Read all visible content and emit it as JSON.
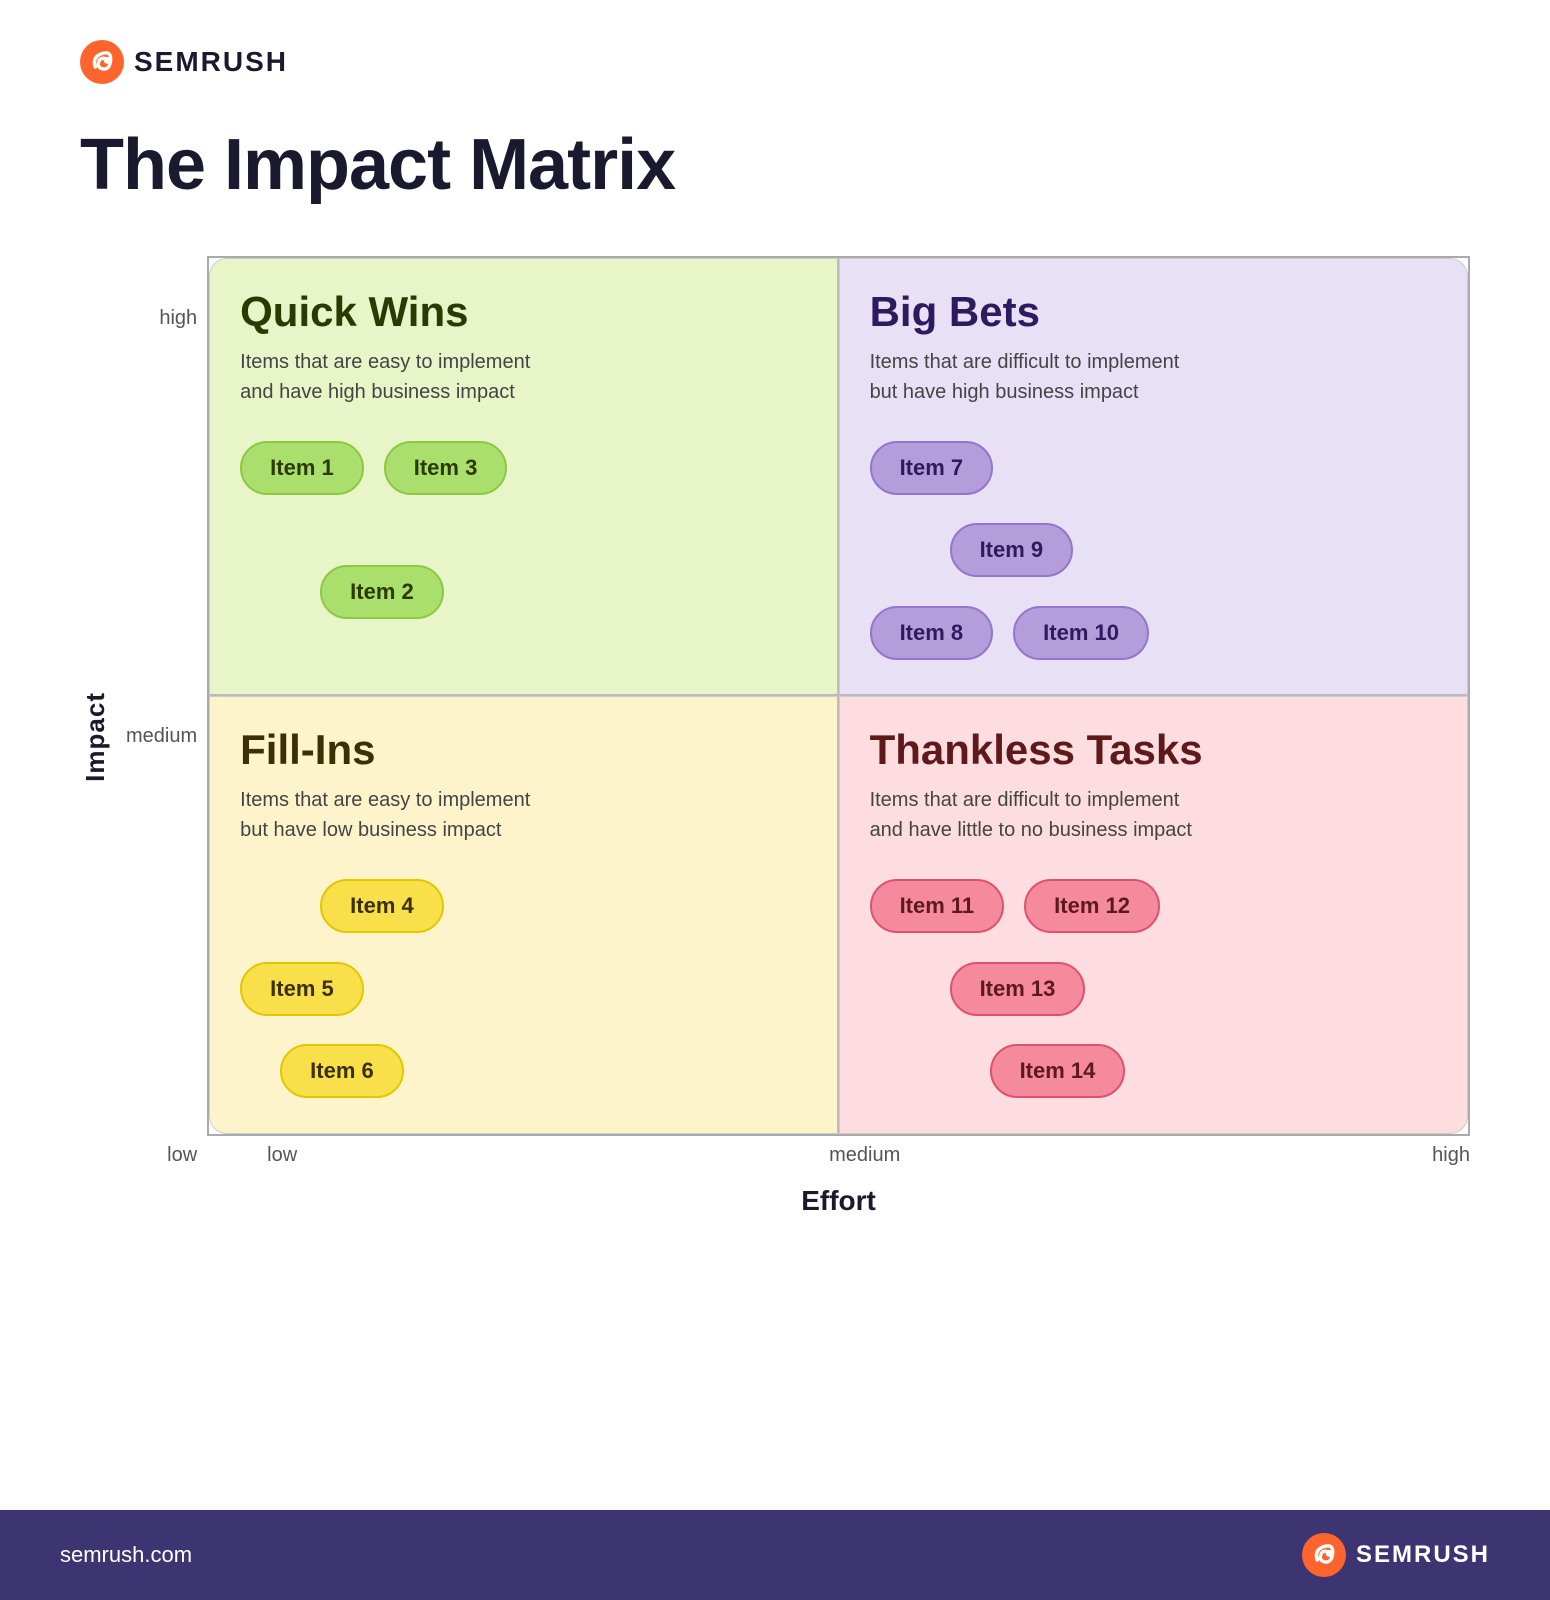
{
  "brand": {
    "name": "SEMRUSH",
    "url": "semrush.com"
  },
  "page": {
    "title": "The Impact Matrix"
  },
  "axes": {
    "y_label": "Impact",
    "x_label": "Effort",
    "y_high": "high",
    "y_medium": "medium",
    "y_low": "low",
    "x_low": "low",
    "x_medium": "medium",
    "x_high": "high"
  },
  "quadrants": {
    "quick_wins": {
      "title": "Quick Wins",
      "description": "Items that are easy to implement\nand have high business impact",
      "items": [
        "Item 1",
        "Item 2",
        "Item 3"
      ]
    },
    "big_bets": {
      "title": "Big Bets",
      "description": "Items that are difficult to implement\nbut have high business impact",
      "items": [
        "Item 7",
        "Item 8",
        "Item 9",
        "Item 10"
      ]
    },
    "fill_ins": {
      "title": "Fill-Ins",
      "description": "Items that are easy to implement\nbut have low business impact",
      "items": [
        "Item 4",
        "Item 5",
        "Item 6"
      ]
    },
    "thankless_tasks": {
      "title": "Thankless Tasks",
      "description": "Items that are difficult to implement\nand have little to no business impact",
      "items": [
        "Item 11",
        "Item 12",
        "Item 13",
        "Item 14"
      ]
    }
  }
}
